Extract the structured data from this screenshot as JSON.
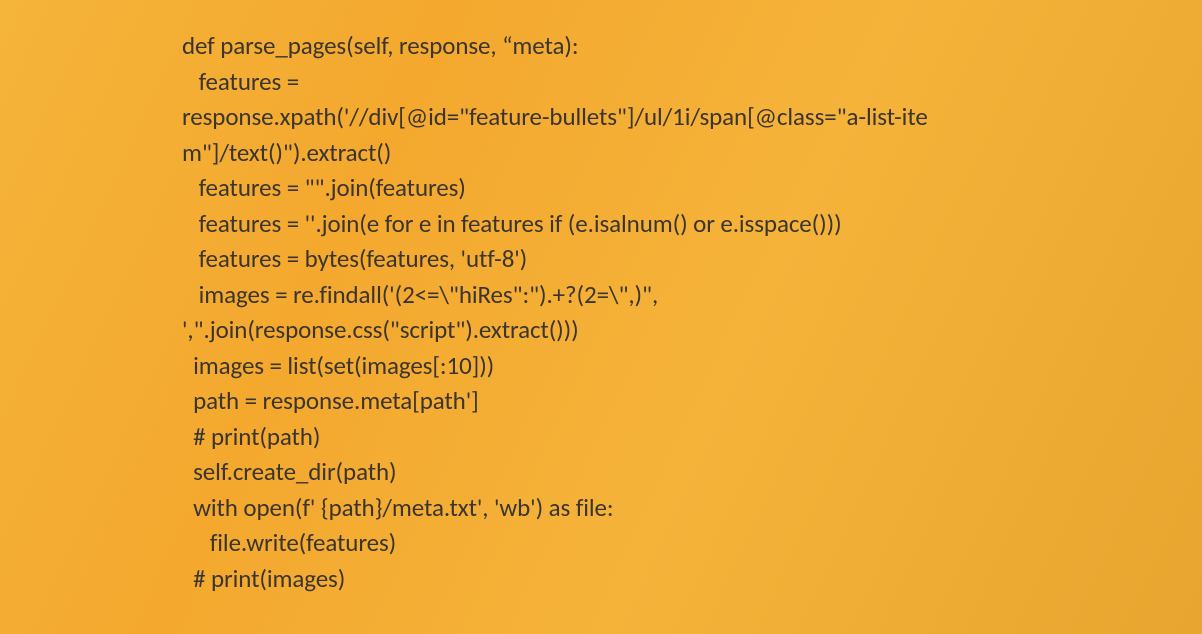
{
  "code": {
    "lines": [
      "def parse_pages(self, response, “meta):",
      "   features =",
      "response.xpath('//div[@id=\"feature-bullets\"]/ul/1i/span[@class=\"a-list-ite",
      "m\"]/text()\").extract()",
      "   features = \"\".join(features)",
      "   features = ''.join(e for e in features if (e.isalnum() or e.isspace()))",
      "   features = bytes(features, 'utf-8')",
      "   images = re.findall('(2<=\\\"hiRes\":\").+?(2=\\\",)\",",
      "',\".join(response.css(\"script\").extract()))",
      "  images = list(set(images[:10]))",
      "  path = response.meta[path']",
      "  # print(path)",
      "  self.create_dir(path)",
      "  with open(f' {path}/meta.txt', 'wb') as file:",
      "     file.write(features)",
      "  # print(images)"
    ]
  }
}
